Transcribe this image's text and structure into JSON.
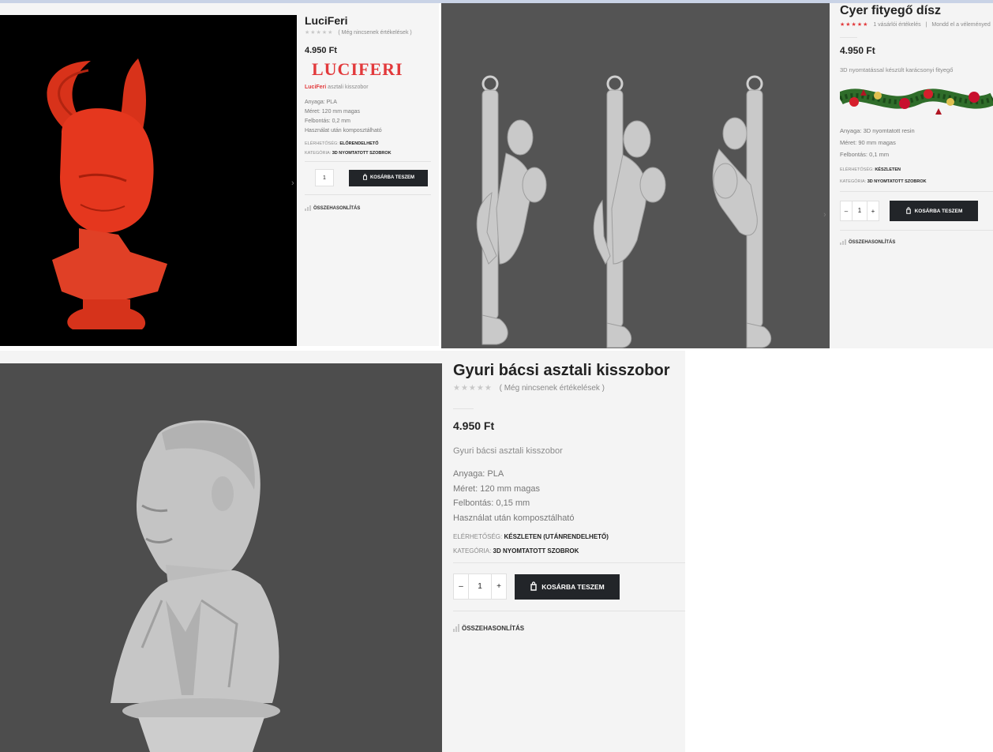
{
  "products": {
    "luciferi": {
      "title": "LuciFeri",
      "stars": "★★★★★",
      "reviews": "( Még nincsenek értékelések )",
      "price": "4.950 Ft",
      "banner": "LUCIFERI",
      "desc_highlight": "LuciFeri",
      "desc_rest": " asztali kisszobor",
      "specs": [
        "Anyaga: PLA",
        "Méret: 120 mm magas",
        "Felbontás: 0,2 mm",
        "Használat után komposztálható"
      ],
      "availability_label": "Elérhetőség:",
      "availability_value": "Előrendelhető",
      "category_label": "Kategória:",
      "category_value": "3D nyomtatott szobrok",
      "qty": "1",
      "cart": "Kosárba teszem",
      "compare": "Összehasonlítás"
    },
    "cyer": {
      "title": "Cyer fityegő dísz",
      "stars": "★★★★★",
      "reviews": "1 vásárlói értékelés",
      "separator": "|",
      "review_link": "Mondd el a véleményed",
      "price": "4.950 Ft",
      "desc": "3D nyomtatással készült karácsonyi fityegő",
      "specs": [
        "Anyaga: 3D nyomtatott resin",
        "Méret: 90 mm magas",
        "Felbontás: 0,1 mm"
      ],
      "availability_label": "Elérhetőség:",
      "availability_value": "Készleten",
      "category_label": "Kategória:",
      "category_value": "3D nyomtatott szobrok",
      "minus": "–",
      "qty": "1",
      "plus": "+",
      "cart": "Kosárba teszem",
      "compare": "Összehasonlítás"
    },
    "gyuri": {
      "title": "Gyuri bácsi asztali kisszobor",
      "stars": "★★★★★",
      "reviews": "( Még nincsenek értékelések )",
      "price": "4.950 Ft",
      "desc": "Gyuri bácsi asztali kisszobor",
      "specs": [
        "Anyaga: PLA",
        "Méret: 120 mm magas",
        "Felbontás: 0,15 mm",
        "Használat után komposztálható"
      ],
      "availability_label": "Elérhetőség:",
      "availability_value": "Készleten (Utánrendelhető)",
      "category_label": "Kategória:",
      "category_value": "3D nyomtatott szobrok",
      "minus": "–",
      "qty": "1",
      "plus": "+",
      "cart": "Kosárba teszem",
      "compare": "Összehasonlítás"
    }
  },
  "icons": {
    "gallery_next": "chevron-right-icon",
    "cart": "shopping-bag-icon",
    "compare": "bar-chart-icon"
  },
  "colors": {
    "accent_red": "#e2393b",
    "button_dark": "#222529",
    "statue_red": "#e5371e",
    "statue_grey": "#c9c9c9"
  }
}
